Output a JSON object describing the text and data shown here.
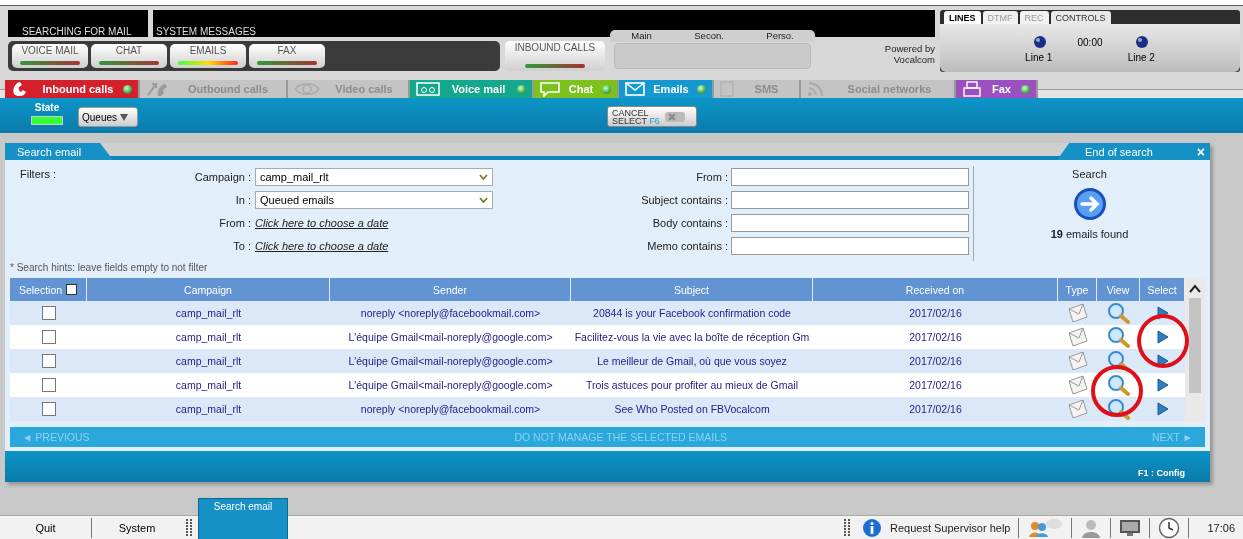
{
  "status_panels": [
    {
      "label": "SEARCHING FOR MAIL"
    },
    {
      "label": "SYSTEM MESSAGES"
    }
  ],
  "media_buttons": [
    {
      "label": "VOICE MAIL",
      "active": false
    },
    {
      "label": "CHAT",
      "active": false
    },
    {
      "label": "EMAILS",
      "active": true
    },
    {
      "label": "FAX",
      "active": false
    }
  ],
  "inbound_button": {
    "label": "INBOUND CALLS"
  },
  "queue_columns": [
    "Main",
    "Secon.",
    "Perso."
  ],
  "powered_by": [
    "Powered by",
    "Vocalcom"
  ],
  "lines_panel": {
    "tabs": [
      {
        "label": "LINES",
        "selected": true,
        "disabled": false
      },
      {
        "label": "DTMF",
        "selected": false,
        "disabled": true
      },
      {
        "label": "REC",
        "selected": false,
        "disabled": true
      },
      {
        "label": "CONTROLS",
        "selected": false,
        "disabled": false
      }
    ],
    "timer": "00:00",
    "lines": [
      "Line 1",
      "Line 2"
    ]
  },
  "channel_tabs": [
    {
      "label": "Inbound calls",
      "color": "#d3202c",
      "disabled": false
    },
    {
      "label": "Outbound calls",
      "color": "#c4c4c4",
      "disabled": true
    },
    {
      "label": "Video calls",
      "color": "#c4c4c4",
      "disabled": true
    },
    {
      "label": "Voice mail",
      "color": "#13a88e",
      "disabled": false
    },
    {
      "label": "Chat",
      "color": "#7cc11c",
      "disabled": false
    },
    {
      "label": "Emails",
      "color": "#1598cf",
      "disabled": false
    },
    {
      "label": "SMS",
      "color": "#c4c4c4",
      "disabled": true
    },
    {
      "label": "Social networks",
      "color": "#c4c4c4",
      "disabled": true
    },
    {
      "label": "Fax",
      "color": "#9b4fc0",
      "disabled": false
    }
  ],
  "toolbar": {
    "state_label": "State",
    "queues": "Queues",
    "cancel_lines": [
      "CANCEL",
      "SELECT"
    ],
    "cancel_key": "F6"
  },
  "search_panel": {
    "tab": "Search email",
    "end_button": "End of search",
    "close": "×",
    "filters_label": "Filters :",
    "left_fields": [
      {
        "label": "Campaign :",
        "kind": "select",
        "value": "camp_mail_rlt"
      },
      {
        "label": "In :",
        "kind": "select",
        "value": "Queued emails"
      },
      {
        "label": "From :",
        "kind": "link",
        "value": "Click here to choose a date"
      },
      {
        "label": "To :",
        "kind": "link",
        "value": "Click here to choose a date"
      }
    ],
    "right_fields": [
      {
        "label": "From :"
      },
      {
        "label": "Subject contains :"
      },
      {
        "label": "Body contains :"
      },
      {
        "label": "Memo contains :"
      }
    ],
    "search_label": "Search",
    "results": "**19** emails found",
    "hint": "* Search hints: leave fields empty to not filter"
  },
  "table": {
    "columns": [
      "Selection",
      "Campaign",
      "Sender",
      "Subject",
      "Received on",
      "Type",
      "View",
      "Select"
    ],
    "select_all_checked": false,
    "rows": [
      {
        "checked": false,
        "campaign": "camp_mail_rlt",
        "sender": "noreply <noreply@facebookmail.com>",
        "subject": "20844 is your Facebook confirmation code",
        "received": "2017/02/16"
      },
      {
        "checked": false,
        "campaign": "camp_mail_rlt",
        "sender": "L'équipe Gmail<mail-noreply@google.com>",
        "subject": "Facilitez-vous la vie avec la boîte de réception Gm",
        "received": "2017/02/16"
      },
      {
        "checked": false,
        "campaign": "camp_mail_rlt",
        "sender": "L'équipe Gmail<mail-noreply@google.com>",
        "subject": "Le meilleur de Gmail, où que vous soyez",
        "received": "2017/02/16"
      },
      {
        "checked": false,
        "campaign": "camp_mail_rlt",
        "sender": "L'équipe Gmail<mail-noreply@google.com>",
        "subject": "Trois astuces pour profiter au mieux de Gmail",
        "received": "2017/02/16"
      },
      {
        "checked": false,
        "campaign": "camp_mail_rlt",
        "sender": "noreply <noreply@facebookmail.com>",
        "subject": "See Who Posted on FBVocalcom",
        "received": "2017/02/16"
      }
    ]
  },
  "pager": [
    {
      "label": "◄ PREVIOUS",
      "disabled": true
    },
    {
      "label": "DO NOT MANAGE THE SELECTED EMAILS",
      "disabled": true
    },
    {
      "label": "NEXT ►",
      "disabled": true
    }
  ],
  "footer": {
    "config": "F1 : Config"
  },
  "taskbar": {
    "buttons": [
      "Quit",
      "System"
    ],
    "window_tab": {
      "label": "Search email",
      "selected": true
    },
    "help": "Request Supervisor help",
    "clock": "17:06"
  }
}
